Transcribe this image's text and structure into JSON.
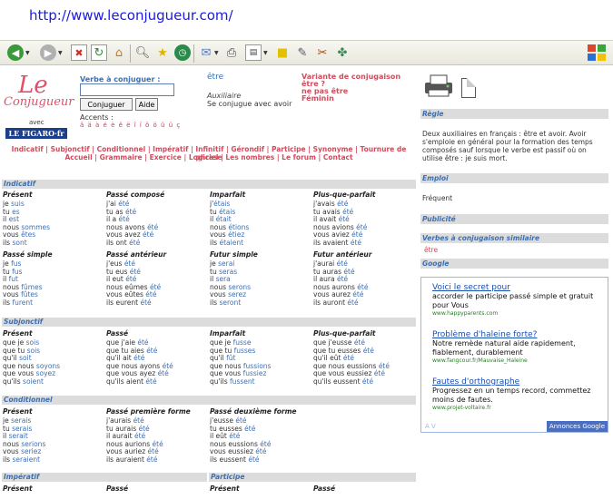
{
  "browser": {
    "url": "http://www.leconjugueur.com/"
  },
  "header": {
    "logo_le": "Le",
    "logo_conjugueur": "Conjugueur",
    "logo_avec": "avec",
    "logo_figaro": "LE FIGARO·fr",
    "search_label": "Verbe à conjuguer :",
    "search_value": "",
    "conjuguer_button": "Conjuguer",
    "aide_button": "Aide",
    "accents_label": "Accents :",
    "accents": "â ä à é è ê ë î ï ô ö û ü ç",
    "verb": "être",
    "aux_label": "Auxiliaire",
    "aux_text": "Se conjugue avec avoir",
    "variant_head": "Variante de conjugaison",
    "variants": [
      "être ?",
      "ne pas être",
      "Féminin"
    ]
  },
  "nav": {
    "row1": "Indicatif | Subjonctif | Conditionnel | Impératif | Infinitif | Gérondif | Participe | Synonyme | Tournure de phrase",
    "row2": "Accueil | Grammaire | Exercice | Logiciel | Les nombres | Le forum | Contact"
  },
  "sections": {
    "indicatif": "Indicatif",
    "subjonctif": "Subjonctif",
    "conditionnel": "Conditionnel",
    "imperatif": "Impératif",
    "participe": "Participe"
  },
  "tenses": {
    "present": {
      "name": "Présent",
      "rows": [
        [
          "je ",
          "suis"
        ],
        [
          "tu ",
          "es"
        ],
        [
          "il ",
          "est"
        ],
        [
          "nous ",
          "sommes"
        ],
        [
          "vous ",
          "êtes"
        ],
        [
          "ils ",
          "sont"
        ]
      ]
    },
    "passe_compose": {
      "name": "Passé composé",
      "rows": [
        [
          "j'ai ",
          "été"
        ],
        [
          "tu as ",
          "été"
        ],
        [
          "il a ",
          "été"
        ],
        [
          "nous avons ",
          "été"
        ],
        [
          "vous avez ",
          "été"
        ],
        [
          "ils ont ",
          "été"
        ]
      ]
    },
    "imparfait": {
      "name": "Imparfait",
      "rows": [
        [
          "j'",
          "étais"
        ],
        [
          "tu ",
          "étais"
        ],
        [
          "il ",
          "était"
        ],
        [
          "nous ",
          "étions"
        ],
        [
          "vous ",
          "étiez"
        ],
        [
          "ils ",
          "étaient"
        ]
      ]
    },
    "plus_que_parfait": {
      "name": "Plus-que-parfait",
      "rows": [
        [
          "j'avais ",
          "été"
        ],
        [
          "tu avais ",
          "été"
        ],
        [
          "il avait ",
          "été"
        ],
        [
          "nous avions ",
          "été"
        ],
        [
          "vous aviez ",
          "été"
        ],
        [
          "ils avaient ",
          "été"
        ]
      ]
    },
    "passe_simple": {
      "name": "Passé simple",
      "rows": [
        [
          "je ",
          "fus"
        ],
        [
          "tu ",
          "fus"
        ],
        [
          "il ",
          "fut"
        ],
        [
          "nous ",
          "fûmes"
        ],
        [
          "vous ",
          "fûtes"
        ],
        [
          "ils ",
          "furent"
        ]
      ]
    },
    "passe_anterieur": {
      "name": "Passé antérieur",
      "rows": [
        [
          "j'eus ",
          "été"
        ],
        [
          "tu eus ",
          "été"
        ],
        [
          "il eut ",
          "été"
        ],
        [
          "nous eûmes ",
          "été"
        ],
        [
          "vous eûtes ",
          "été"
        ],
        [
          "ils eurent ",
          "été"
        ]
      ]
    },
    "futur_simple": {
      "name": "Futur simple",
      "rows": [
        [
          "je ",
          "serai"
        ],
        [
          "tu ",
          "seras"
        ],
        [
          "il ",
          "sera"
        ],
        [
          "nous ",
          "serons"
        ],
        [
          "vous ",
          "serez"
        ],
        [
          "ils ",
          "seront"
        ]
      ]
    },
    "futur_anterieur": {
      "name": "Futur antérieur",
      "rows": [
        [
          "j'aurai ",
          "été"
        ],
        [
          "tu auras ",
          "été"
        ],
        [
          "il aura ",
          "été"
        ],
        [
          "nous aurons ",
          "été"
        ],
        [
          "vous aurez ",
          "été"
        ],
        [
          "ils auront ",
          "été"
        ]
      ]
    },
    "subj_present": {
      "name": "Présent",
      "rows": [
        [
          "que je ",
          "sois"
        ],
        [
          "que tu ",
          "sois"
        ],
        [
          "qu'il ",
          "soit"
        ],
        [
          "que nous ",
          "soyons"
        ],
        [
          "que vous ",
          "soyez"
        ],
        [
          "qu'ils ",
          "soient"
        ]
      ]
    },
    "subj_passe": {
      "name": "Passé",
      "rows": [
        [
          "que j'aie ",
          "été"
        ],
        [
          "que tu aies ",
          "été"
        ],
        [
          "qu'il ait ",
          "été"
        ],
        [
          "que nous ayons ",
          "été"
        ],
        [
          "que vous ayez ",
          "été"
        ],
        [
          "qu'ils aient ",
          "été"
        ]
      ]
    },
    "subj_imparfait": {
      "name": "Imparfait",
      "rows": [
        [
          "que je ",
          "fusse"
        ],
        [
          "que tu ",
          "fusses"
        ],
        [
          "qu'il ",
          "fût"
        ],
        [
          "que nous ",
          "fussions"
        ],
        [
          "que vous ",
          "fussiez"
        ],
        [
          "qu'ils ",
          "fussent"
        ]
      ]
    },
    "subj_pqp": {
      "name": "Plus-que-parfait",
      "rows": [
        [
          "que j'eusse ",
          "été"
        ],
        [
          "que tu eusses ",
          "été"
        ],
        [
          "qu'il eût ",
          "été"
        ],
        [
          "que nous eussions ",
          "été"
        ],
        [
          "que vous eussiez ",
          "été"
        ],
        [
          "qu'ils eussent ",
          "été"
        ]
      ]
    },
    "cond_present": {
      "name": "Présent",
      "rows": [
        [
          "je ",
          "serais"
        ],
        [
          "tu ",
          "serais"
        ],
        [
          "il ",
          "serait"
        ],
        [
          "nous ",
          "serions"
        ],
        [
          "vous ",
          "seriez"
        ],
        [
          "ils ",
          "seraient"
        ]
      ]
    },
    "cond_passe1": {
      "name": "Passé première forme",
      "rows": [
        [
          "j'aurais ",
          "été"
        ],
        [
          "tu aurais ",
          "été"
        ],
        [
          "il aurait ",
          "été"
        ],
        [
          "nous aurions ",
          "été"
        ],
        [
          "vous auriez ",
          "été"
        ],
        [
          "ils auraient ",
          "été"
        ]
      ]
    },
    "cond_passe2": {
      "name": "Passé deuxième forme",
      "rows": [
        [
          "j'eusse ",
          "été"
        ],
        [
          "tu eusses ",
          "été"
        ],
        [
          "il eût ",
          "été"
        ],
        [
          "nous eussions ",
          "été"
        ],
        [
          "vous eussiez ",
          "été"
        ],
        [
          "ils eussent ",
          "été"
        ]
      ]
    },
    "imp_present": {
      "name": "Présent",
      "rows": []
    },
    "imp_passe": {
      "name": "Passé",
      "rows": []
    },
    "part_present": {
      "name": "Présent",
      "rows": []
    },
    "part_passe": {
      "name": "Passé",
      "rows": []
    }
  },
  "sidebar": {
    "regle_head": "Règle",
    "regle_text": "Deux auxiliaires en français : être et avoir. Avoir s'emploie en général pour la formation des temps composés sauf lorsque le verbe est passif où on utilise être : je suis mort.",
    "emploi_head": "Emploi",
    "emploi_text": "Fréquent",
    "publicite_head": "Publicité",
    "similaire_head": "Verbes à conjugaison similaire",
    "similaire_text": "être",
    "google_head": "Google"
  },
  "ads": [
    {
      "title": "Voici le secret pour",
      "desc": "accorder le participe passé simple et gratuit pour Vous",
      "url": "www.happyparents.com"
    },
    {
      "title": "Problème d'haleine forte?",
      "desc": "Notre remède natural aide rapidement, fiablement, durablement",
      "url": "www.fangcour.fr/Mauvaise_Haleine"
    },
    {
      "title": "Fautes d'orthographe",
      "desc": "Progressez en un temps record, commettez moins de fautes.",
      "url": "www.projet-voltaire.fr"
    }
  ],
  "ads_footer": "Annonces Google",
  "ads_av": "A V",
  "colors": {
    "link": "#3d6fb0",
    "accent": "#d44a5c",
    "header_bg": "#dcdcdc"
  }
}
